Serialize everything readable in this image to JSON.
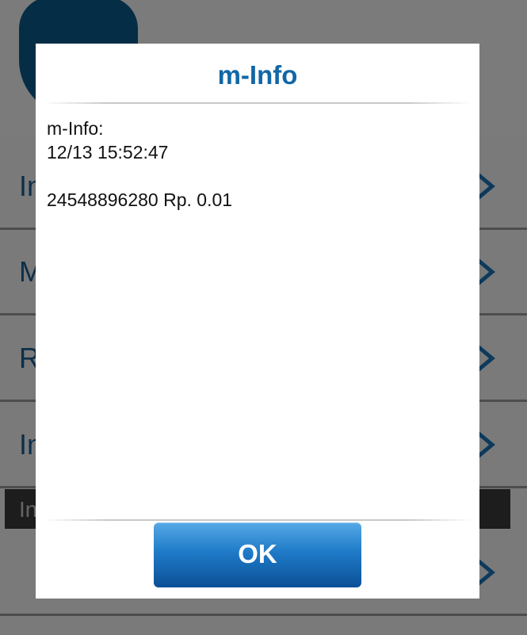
{
  "background": {
    "menu_items": [
      {
        "label": "In"
      },
      {
        "label": "M"
      },
      {
        "label": "R"
      },
      {
        "label": "In"
      }
    ],
    "section_header": "In",
    "icons": {
      "logo": "shield-logo",
      "row_arrow": "chevron-right-icon"
    }
  },
  "dialog": {
    "title": "m-Info",
    "message_line1": "m-Info:",
    "message_line2": "12/13 15:52:47",
    "message_line3": "",
    "message_line4": "24548896280 Rp. 0.01",
    "ok_label": "OK"
  },
  "colors": {
    "title": "#1267a6",
    "button_top": "#56a9e6",
    "button_bottom": "#0b4f96",
    "brand": "#1b5e92"
  }
}
